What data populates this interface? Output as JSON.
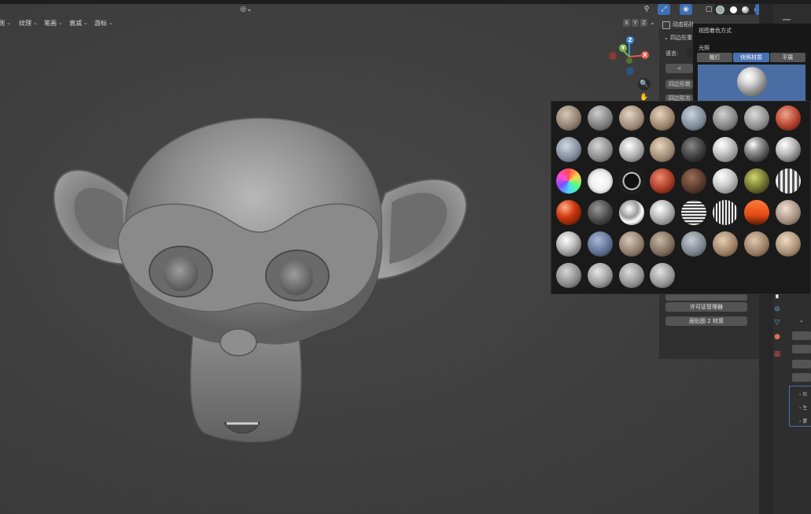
{
  "header": {
    "menus": [
      {
        "label": "刷",
        "x_left": 0
      },
      {
        "label": "纹理"
      },
      {
        "label": "笔画"
      },
      {
        "label": "衰减"
      },
      {
        "label": "游标"
      }
    ]
  },
  "navigation": {
    "axis_x": "X",
    "axis_y": "Y",
    "axis_z": "Z",
    "gizmo_labels": {
      "x": "X",
      "y": "Y",
      "z": "Z"
    }
  },
  "npanel": {
    "title": "动态拓扑",
    "section": "四边形重",
    "language_label": "语言:",
    "button_1": "四边形数",
    "button_2": "四边形方",
    "button_license": "许可证管理器",
    "button_material": "面贴图 2 材质"
  },
  "shading_popover": {
    "title": "视图着色方式",
    "lighting_label": "光照",
    "lighting_options": [
      "棚灯",
      "快照材质",
      "平展"
    ],
    "lighting_selected": "快照材质"
  },
  "matcaps": {
    "count": 44,
    "columns": 8
  },
  "properties_panel": {
    "rows": [
      "形",
      "生",
      "蒙"
    ]
  },
  "colors": {
    "accent": "#4772b3",
    "axis_x": "#e35b4b",
    "axis_y": "#7fb24a",
    "axis_z": "#3d88d8"
  }
}
